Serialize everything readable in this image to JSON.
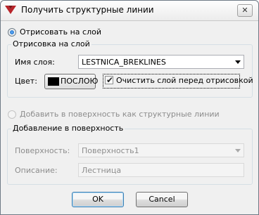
{
  "window": {
    "title": "Получить структурные линии"
  },
  "layer_option": {
    "radio_label": "Отрисовать на слой",
    "selected": true,
    "group_title": "Отрисовка на слой",
    "layer_name_label": "Имя слоя:",
    "layer_name_value": "LESTNICA_BREKLINES",
    "color_label": "Цвет:",
    "color_value": "ПОСЛОЮ",
    "color_swatch": "#000000",
    "clear_label": "Очистить слой перед отрисовкой",
    "clear_checked": true
  },
  "surface_option": {
    "radio_label": "Добавить в поверхность как структурные линии",
    "selected": false,
    "enabled": false,
    "group_title": "Добавление в поверхность",
    "surface_label": "Поверхность:",
    "surface_value": "Поверхность1",
    "description_label": "Описание:",
    "description_value": "Лестница"
  },
  "buttons": {
    "ok": "OK",
    "cancel": "Cancel"
  },
  "icons": {
    "app": "civil3d-app-icon",
    "close": "close-icon"
  }
}
